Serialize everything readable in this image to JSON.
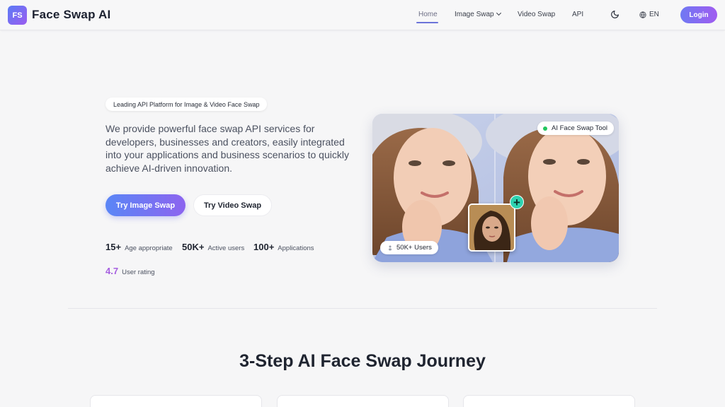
{
  "header": {
    "logo_initials": "FS",
    "brand": "Face Swap AI",
    "nav": {
      "home": "Home",
      "image_swap": "Image Swap",
      "video_swap": "Video Swap",
      "api": "API"
    },
    "theme_icon": "moon-icon",
    "language": "EN",
    "login": "Login"
  },
  "hero": {
    "badge": " Leading API Platform for Image & Video Face Swap",
    "description": "We provide powerful face swap API services for developers, businesses and creators, easily integrated into your applications and business scenarios to quickly achieve AI-driven innovation.",
    "primary_button": "Try Image Swap",
    "secondary_button": "Try Video Swap",
    "stats": [
      {
        "value": "15+",
        "label": "Age appropriate"
      },
      {
        "value": "50K+",
        "label": "Active users"
      },
      {
        "value": "100+",
        "label": "Applications"
      }
    ],
    "rating": {
      "value": "4.7",
      "label": "User rating"
    },
    "image_tag": "AI Face Swap Tool",
    "users_tag": "50K+ Users",
    "users_icon": "user-icon"
  },
  "steps_section": {
    "title": "3-Step AI Face Swap Journey"
  },
  "colors": {
    "accent_start": "#5a86f6",
    "accent_end": "#8c64ef",
    "rating": "#a660e0",
    "online_dot": "#22c55e",
    "plus": "#2ed3b0"
  }
}
